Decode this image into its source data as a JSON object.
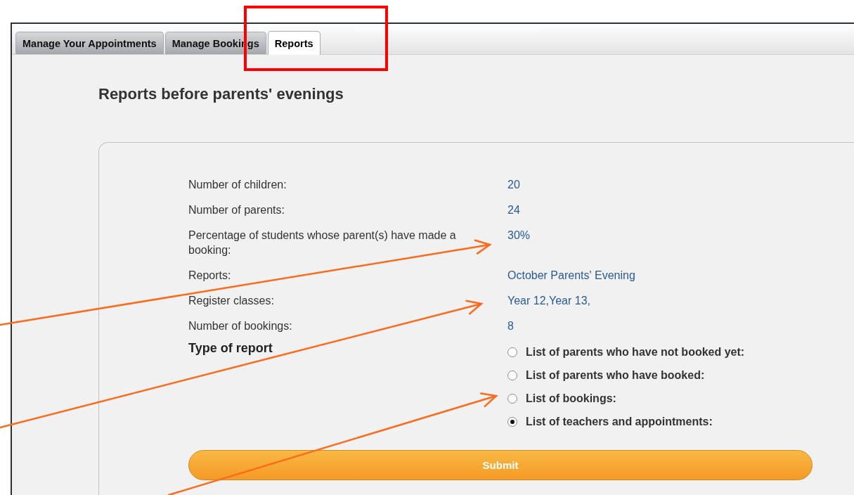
{
  "tabs": [
    {
      "label": "Manage Your Appointments",
      "selected": false
    },
    {
      "label": "Manage Bookings",
      "selected": false
    },
    {
      "label": "Reports",
      "selected": true
    }
  ],
  "title": "Reports before parents' evenings",
  "stats": [
    {
      "label": "Number of children:",
      "value": "20"
    },
    {
      "label": "Number of parents:",
      "value": "24"
    },
    {
      "label": "Percentage of students whose parent(s) have made a booking:",
      "value": "30%"
    },
    {
      "label": "Reports:",
      "value": "October Parents' Evening"
    },
    {
      "label": "Register classes:",
      "value": "Year 12,Year 13,"
    },
    {
      "label": "Number of bookings:",
      "value": "8"
    }
  ],
  "report_type": {
    "heading": "Type of report",
    "options": [
      {
        "label": "List of parents who have not booked yet:",
        "selected": false
      },
      {
        "label": "List of parents who have booked:",
        "selected": false
      },
      {
        "label": "List of bookings:",
        "selected": false
      },
      {
        "label": "List of teachers and appointments:",
        "selected": true
      }
    ]
  },
  "submit": "Submit"
}
